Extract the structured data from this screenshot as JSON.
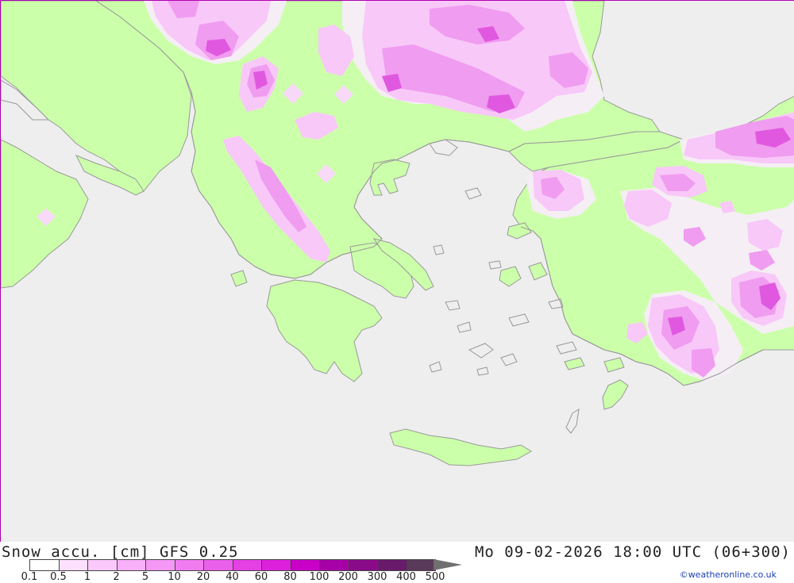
{
  "map": {
    "region": "Greece / Aegean Sea",
    "colors": {
      "sea": "#eeeeee",
      "land": "#ccffaa",
      "coast": "#999999",
      "snow_light": "#f8d0f8",
      "snow_mid": "#f0a0f0",
      "snow_strong": "#e050e0",
      "snow_pale": "#f5eef5"
    }
  },
  "footer": {
    "title_left": "Snow accu. [cm] GFS 0.25",
    "title_right": "Mo 09-02-2026 18:00 UTC (06+300)",
    "credit": "©weatheronline.co.uk"
  },
  "legend": {
    "labels": [
      "0.1",
      "0.5",
      "1",
      "2",
      "5",
      "10",
      "20",
      "40",
      "60",
      "80",
      "100",
      "200",
      "300",
      "400",
      "500"
    ],
    "colors": [
      "#ffffff",
      "#fde0fd",
      "#fbc8fb",
      "#f8b0f8",
      "#f598f5",
      "#f07cf0",
      "#ea60ea",
      "#e440e4",
      "#dc20dc",
      "#c800c8",
      "#a800a8",
      "#8a0a8a",
      "#6a1a6a",
      "#5a3a5a"
    ],
    "arrow_color": "#707070"
  }
}
